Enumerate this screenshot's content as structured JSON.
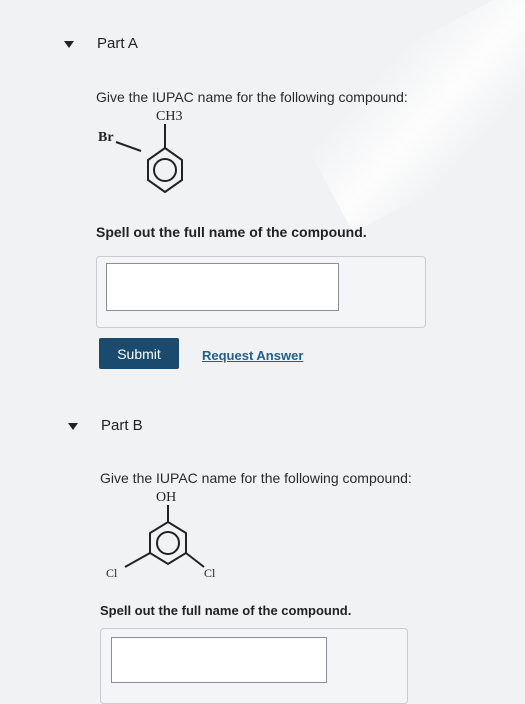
{
  "part_a": {
    "title": "Part A",
    "prompt": "Give the IUPAC name for the following compound:",
    "structure": {
      "top_group": "CH3",
      "side_group": "Br"
    },
    "instruction": "Spell out the full name of the compound.",
    "answer_value": "",
    "submit_label": "Submit",
    "request_label": "Request Answer"
  },
  "part_b": {
    "title": "Part B",
    "prompt": "Give the IUPAC name for the following compound:",
    "structure": {
      "top_group": "OH",
      "left_group": "Cl",
      "right_group": "Cl"
    },
    "instruction": "Spell out the full name of the compound.",
    "answer_value": ""
  },
  "colors": {
    "submit_bg": "#1a4b6e",
    "link": "#1f5f8f"
  }
}
